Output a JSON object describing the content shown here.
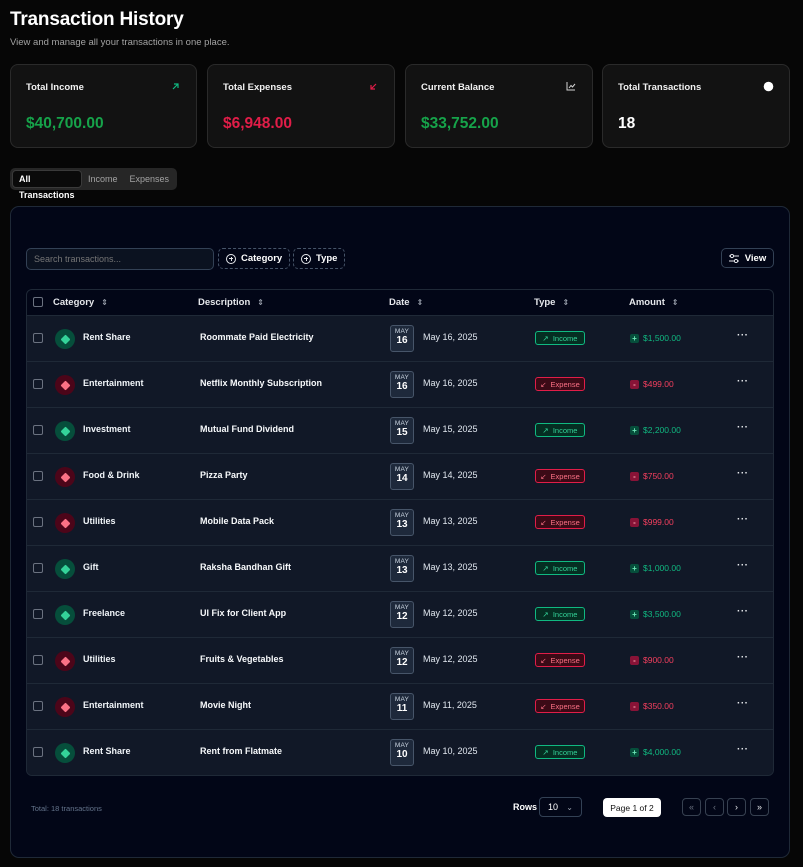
{
  "header": {
    "title": "Transaction History",
    "subtitle": "View and manage all your transactions in one place."
  },
  "stats": [
    {
      "label": "Total Income",
      "value": "$40,700.00",
      "color": "#16a34a",
      "icon": "arrow-up-right-icon"
    },
    {
      "label": "Total Expenses",
      "value": "$6,948.00",
      "color": "#e11d48",
      "icon": "arrow-down-left-icon"
    },
    {
      "label": "Current Balance",
      "value": "$33,752.00",
      "color": "#16a34a",
      "icon": "chart-line-icon"
    },
    {
      "label": "Total Transactions",
      "value": "18",
      "color": "#ffffff",
      "icon": "circle-icon"
    }
  ],
  "tabs": [
    "All Transactions",
    "Income",
    "Expenses"
  ],
  "toolbar": {
    "search_placeholder": "Search transactions...",
    "category_label": "Category",
    "type_label": "Type",
    "view_label": "View"
  },
  "columns": [
    "Category",
    "Description",
    "Date",
    "Type",
    "Amount"
  ],
  "rows": [
    {
      "category": "Rent Share",
      "description": "Roommate Paid Electricity",
      "month": "MAY",
      "day": "16",
      "date": "May 16, 2025",
      "type": "Income",
      "sign": "+",
      "amount": "$1,500.00"
    },
    {
      "category": "Entertainment",
      "description": "Netflix Monthly Subscription",
      "month": "MAY",
      "day": "16",
      "date": "May 16, 2025",
      "type": "Expense",
      "sign": "-",
      "amount": "$499.00"
    },
    {
      "category": "Investment",
      "description": "Mutual Fund Dividend",
      "month": "MAY",
      "day": "15",
      "date": "May 15, 2025",
      "type": "Income",
      "sign": "+",
      "amount": "$2,200.00"
    },
    {
      "category": "Food & Drink",
      "description": "Pizza Party",
      "month": "MAY",
      "day": "14",
      "date": "May 14, 2025",
      "type": "Expense",
      "sign": "-",
      "amount": "$750.00"
    },
    {
      "category": "Utilities",
      "description": "Mobile Data Pack",
      "month": "MAY",
      "day": "13",
      "date": "May 13, 2025",
      "type": "Expense",
      "sign": "-",
      "amount": "$999.00"
    },
    {
      "category": "Gift",
      "description": "Raksha Bandhan Gift",
      "month": "MAY",
      "day": "13",
      "date": "May 13, 2025",
      "type": "Income",
      "sign": "+",
      "amount": "$1,000.00"
    },
    {
      "category": "Freelance",
      "description": "UI Fix for Client App",
      "month": "MAY",
      "day": "12",
      "date": "May 12, 2025",
      "type": "Income",
      "sign": "+",
      "amount": "$3,500.00"
    },
    {
      "category": "Utilities",
      "description": "Fruits & Vegetables",
      "month": "MAY",
      "day": "12",
      "date": "May 12, 2025",
      "type": "Expense",
      "sign": "-",
      "amount": "$900.00"
    },
    {
      "category": "Entertainment",
      "description": "Movie Night",
      "month": "MAY",
      "day": "11",
      "date": "May 11, 2025",
      "type": "Expense",
      "sign": "-",
      "amount": "$350.00"
    },
    {
      "category": "Rent Share",
      "description": "Rent from Flatmate",
      "month": "MAY",
      "day": "10",
      "date": "May 10, 2025",
      "type": "Income",
      "sign": "+",
      "amount": "$4,000.00"
    }
  ],
  "footer": {
    "total_text": "Total: 18 transactions",
    "rows_label": "Rows",
    "rows_value": "10",
    "page_text": "Page 1 of 2"
  },
  "colors": {
    "income": "#10b981",
    "expense": "#f43f5e",
    "income_icon_bg": "#064e3b",
    "expense_icon_bg": "#4c0519"
  }
}
